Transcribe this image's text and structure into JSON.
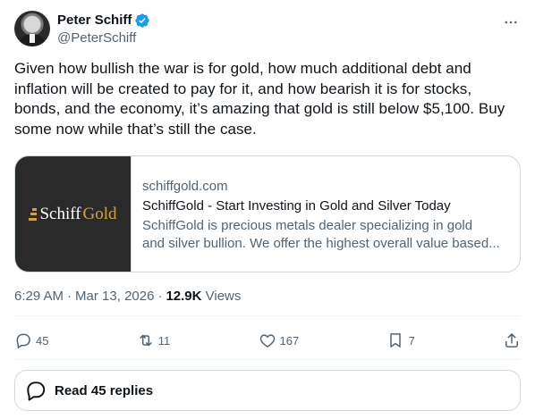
{
  "author": {
    "display_name": "Peter Schiff",
    "handle": "@PeterSchiff"
  },
  "icons": {
    "verified": "verified-badge-icon",
    "more": "more-horizontal-icon",
    "reply": "reply-icon",
    "repost": "repost-icon",
    "like": "like-icon",
    "bookmark": "bookmark-icon",
    "share": "share-icon"
  },
  "colors": {
    "verified": "#1d9bf0",
    "text_secondary": "#536471",
    "gold": "#c9a24a"
  },
  "tweet": {
    "text": "Given how bullish the war is for gold, how much additional debt and inflation will be created to pay for it, and how bearish it is for stocks, bonds, and the economy, it’s amazing that gold is still below $5,100. Buy some now while that’s still the case."
  },
  "link_card": {
    "logo_part1": "Schiff",
    "logo_part2": "Gold",
    "domain": "schiffgold.com",
    "title": "SchiffGold - Start Investing in Gold and Silver Today",
    "description_line1": "SchiffGold is precious metals dealer specializing in gold",
    "description_line2": "and silver bullion. We offer the highest overall value based..."
  },
  "meta": {
    "time": "6:29 AM",
    "sep1": "·",
    "date": "Mar 13, 2026",
    "sep2": "·",
    "views_count": "12.9K",
    "views_label": "Views"
  },
  "actions": {
    "replies": "45",
    "reposts": "11",
    "likes": "167",
    "bookmarks": "7"
  },
  "read_replies": {
    "label": "Read 45 replies"
  }
}
